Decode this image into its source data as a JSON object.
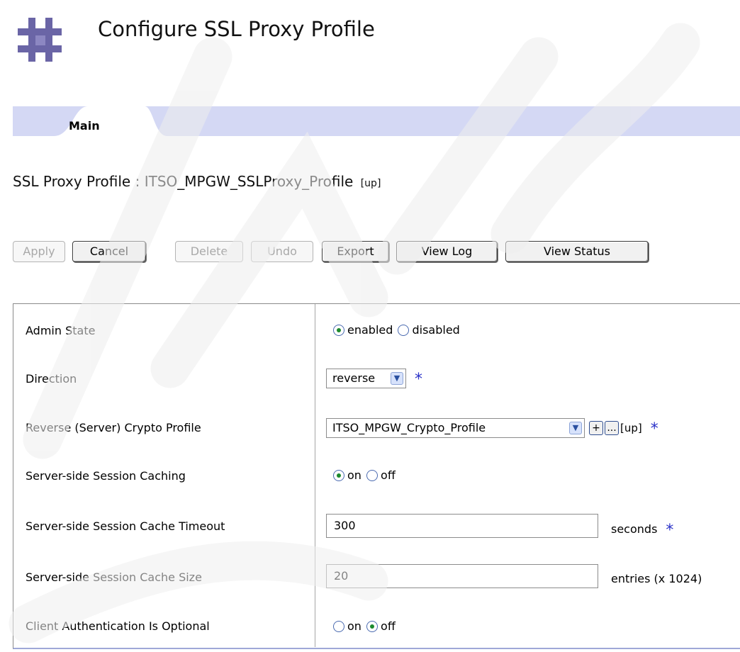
{
  "header": {
    "title": "Configure SSL Proxy Profile",
    "logo_icon": "datapower-hash-icon"
  },
  "tabs": [
    {
      "label": "Main",
      "active": true
    }
  ],
  "object": {
    "type_label": "SSL Proxy Profile",
    "separator": ":",
    "name": "ITSO_MPGW_SSLProxy_Profile",
    "state": "[up]"
  },
  "toolbar": {
    "apply": "Apply",
    "cancel": "Cancel",
    "delete": "Delete",
    "undo": "Undo",
    "export": "Export",
    "view_log": "View Log",
    "view_status": "View Status"
  },
  "form": {
    "admin_state": {
      "label": "Admin State",
      "options": [
        "enabled",
        "disabled"
      ],
      "selected": "enabled"
    },
    "direction": {
      "label": "Direction",
      "value": "reverse",
      "required_mark": "*"
    },
    "reverse_crypto": {
      "label": "Reverse (Server) Crypto Profile",
      "value": "ITSO_MPGW_Crypto_Profile",
      "add": "+",
      "edit": "...",
      "state": "[up]",
      "required_mark": "*"
    },
    "session_caching": {
      "label": "Server-side Session Caching",
      "options": [
        "on",
        "off"
      ],
      "selected": "on"
    },
    "cache_timeout": {
      "label": "Server-side Session Cache Timeout",
      "value": "300",
      "unit": "seconds",
      "required_mark": "*"
    },
    "cache_size": {
      "label": "Server-side Session Cache Size",
      "value": "20",
      "unit": "entries (x 1024)"
    },
    "client_auth_optional": {
      "label": "Client Authentication Is Optional",
      "options": [
        "on",
        "off"
      ],
      "selected": "off"
    }
  },
  "colors": {
    "tab_bar": "#d4d8f4",
    "required_star": "#2b32c8",
    "radio_dot": "#1c8a2e",
    "logo": "#6a65a6"
  }
}
